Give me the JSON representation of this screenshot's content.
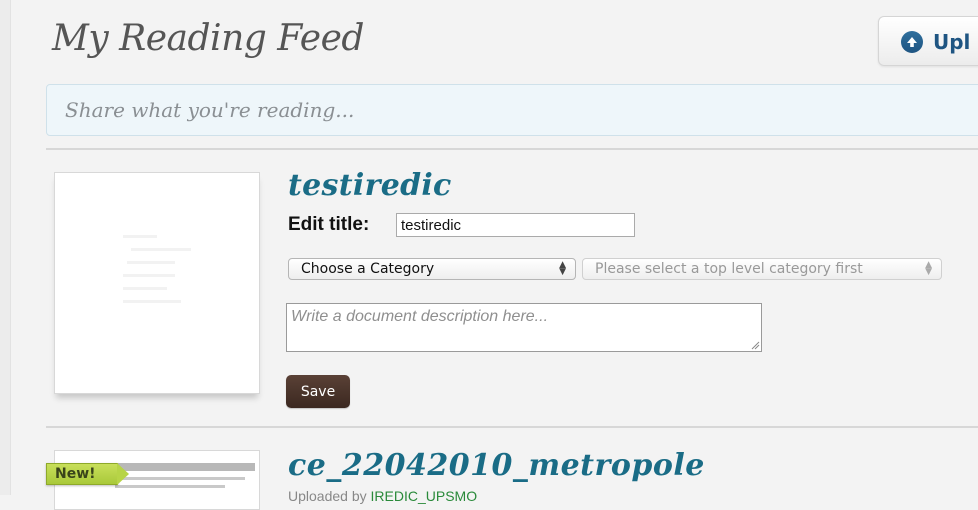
{
  "header": {
    "title": "My Reading Feed",
    "upload_label": "Upl"
  },
  "share": {
    "placeholder": "Share what you're reading..."
  },
  "documents": [
    {
      "title": "testiredic",
      "edit_title_label": "Edit title:",
      "edit_title_value": "testiredic",
      "category_select": "Choose a Category",
      "subcategory_select": "Please select a top level category first",
      "description_placeholder": "Write a document description here...",
      "save_label": "Save"
    },
    {
      "badge": "New!",
      "title": "ce_22042010_metropole",
      "meta_prefix": "Uploaded by",
      "meta_user": "IREDIC_UPSMO"
    }
  ],
  "colors": {
    "title_teal": "#1a6c86",
    "upload_blue": "#1f5582",
    "save_brown": "#4a332a",
    "badge_green": "#b7d447"
  },
  "icons": {
    "upload": "arrow-up-circle-icon",
    "select": "updown-arrows-icon"
  }
}
